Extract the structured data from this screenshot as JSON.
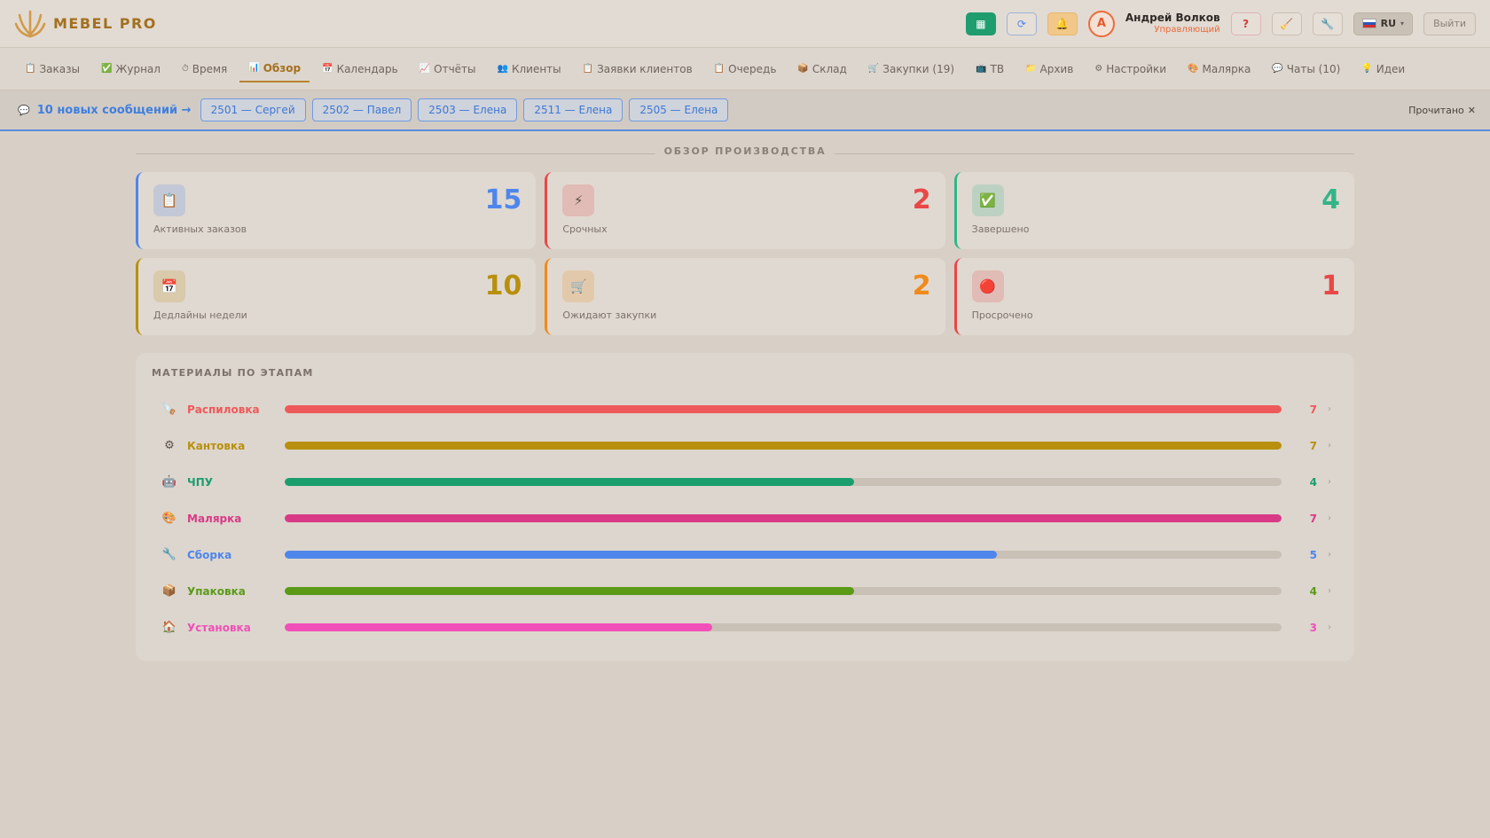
{
  "header": {
    "brand": "MEBEL PRO",
    "user_name": "Андрей Волков",
    "user_role": "Управляющий",
    "avatar_letter": "А",
    "lang": "RU",
    "logout": "Выйти",
    "help": "?"
  },
  "nav": [
    {
      "label": "Заказы",
      "icon": "📋"
    },
    {
      "label": "Журнал",
      "icon": "✅"
    },
    {
      "label": "Время",
      "icon": "⏱"
    },
    {
      "label": "Обзор",
      "icon": "📊",
      "active": true
    },
    {
      "label": "Календарь",
      "icon": "📅"
    },
    {
      "label": "Отчёты",
      "icon": "📈"
    },
    {
      "label": "Клиенты",
      "icon": "👥"
    },
    {
      "label": "Заявки клиентов",
      "icon": "📋"
    },
    {
      "label": "Очередь",
      "icon": "📋"
    },
    {
      "label": "Склад",
      "icon": "📦"
    },
    {
      "label": "Закупки (19)",
      "icon": "🛒"
    },
    {
      "label": "ТВ",
      "icon": "📺"
    },
    {
      "label": "Архив",
      "icon": "📁"
    },
    {
      "label": "Настройки",
      "icon": "⚙"
    },
    {
      "label": "Малярка",
      "icon": "🎨"
    },
    {
      "label": "Чаты (10)",
      "icon": "💬"
    },
    {
      "label": "Идеи",
      "icon": "💡"
    }
  ],
  "messages": {
    "link": "10 новых сообщений →",
    "chips": [
      "2501 — Сергей",
      "2502 — Павел",
      "2503 — Елена",
      "2511 — Елена",
      "2505 — Елена"
    ],
    "read": "Прочитано",
    "close": "✕"
  },
  "overview": {
    "title": "ОБЗОР ПРОИЗВОДСТВА",
    "cards": [
      {
        "label": "Активных заказов",
        "value": "15",
        "icon": "📋",
        "color": "#4f86ec"
      },
      {
        "label": "Срочных",
        "value": "2",
        "icon": "⚡",
        "color": "#e84848"
      },
      {
        "label": "Завершено",
        "value": "4",
        "icon": "✅",
        "color": "#33b587"
      },
      {
        "label": "Дедлайны недели",
        "value": "10",
        "icon": "📅",
        "color": "#b8900e"
      },
      {
        "label": "Ожидают закупки",
        "value": "2",
        "icon": "🛒",
        "color": "#f08a1a"
      },
      {
        "label": "Просрочено",
        "value": "1",
        "icon": "🔴",
        "color": "#e84848"
      }
    ]
  },
  "materials": {
    "title": "МАТЕРИАЛЫ ПО ЭТАПАМ",
    "max": 7,
    "stages": [
      {
        "name": "Распиловка",
        "count": "7",
        "value": 7,
        "icon": "🪚",
        "color": "#ee5a5a"
      },
      {
        "name": "Кантовка",
        "count": "7",
        "value": 7,
        "icon": "⚙",
        "color": "#b8900e"
      },
      {
        "name": "ЧПУ",
        "count": "4",
        "value": 4,
        "icon": "🤖",
        "color": "#1a9e6e"
      },
      {
        "name": "Малярка",
        "count": "7",
        "value": 7,
        "icon": "🎨",
        "color": "#d93a86"
      },
      {
        "name": "Сборка",
        "count": "5",
        "value": 5,
        "icon": "🔧",
        "color": "#4f86ec"
      },
      {
        "name": "Упаковка",
        "count": "4",
        "value": 4,
        "icon": "📦",
        "color": "#5a9a17"
      },
      {
        "name": "Установка",
        "count": "3",
        "value": 3,
        "icon": "🏠",
        "color": "#f050b8"
      }
    ]
  }
}
